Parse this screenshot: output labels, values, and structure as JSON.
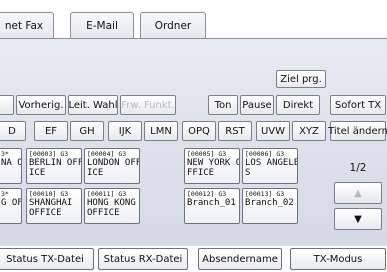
{
  "tabs": [
    {
      "label": "net Fax"
    },
    {
      "label": "E-Mail"
    },
    {
      "label": "Ordner"
    }
  ],
  "toolbar": {
    "ziel_prg": "Ziel prg.",
    "vorherig": "Vorherig.",
    "leit_wahl": "Leit. Wahl",
    "frw_funkt": "Frw. Funkt.",
    "ton": "Ton",
    "pause": "Pause",
    "direkt": "Direkt",
    "sofort_tx": "Sofort TX"
  },
  "index_tabs": [
    "D",
    "EF",
    "GH",
    "IJK",
    "LMN",
    "OPQ",
    "RST",
    "UVW",
    "XYZ",
    "Titel ändern"
  ],
  "destinations": [
    {
      "code": "00003",
      "name": "BERLIN OFF\nICE"
    },
    {
      "code": "00004",
      "name": "LONDON OFF\nICE"
    },
    {
      "code": "00005",
      "name": "NEW YORK O\nFFICE"
    },
    {
      "code": "00006",
      "name": "LOS ANGELE\nS"
    },
    {
      "code": "00010",
      "name": "SHANGHAI\nOFFICE"
    },
    {
      "code": "00011",
      "name": "HONG KONG\nOFFICE"
    },
    {
      "code": "00012",
      "name": "Branch_01"
    },
    {
      "code": "00013",
      "name": "Branch_02"
    }
  ],
  "partial_left": [
    {
      "code": "3*",
      "name": "NA O"
    },
    {
      "code": "3*",
      "name": "G OF"
    }
  ],
  "page": {
    "indicator": "1/2"
  },
  "scroll": {
    "up": "▲",
    "down": "▼"
  },
  "bottom": {
    "status_tx": "Status TX-Datei",
    "status_rx": "Status RX-Datei",
    "absender": "Absendername",
    "tx_modus": "TX-Modus"
  }
}
